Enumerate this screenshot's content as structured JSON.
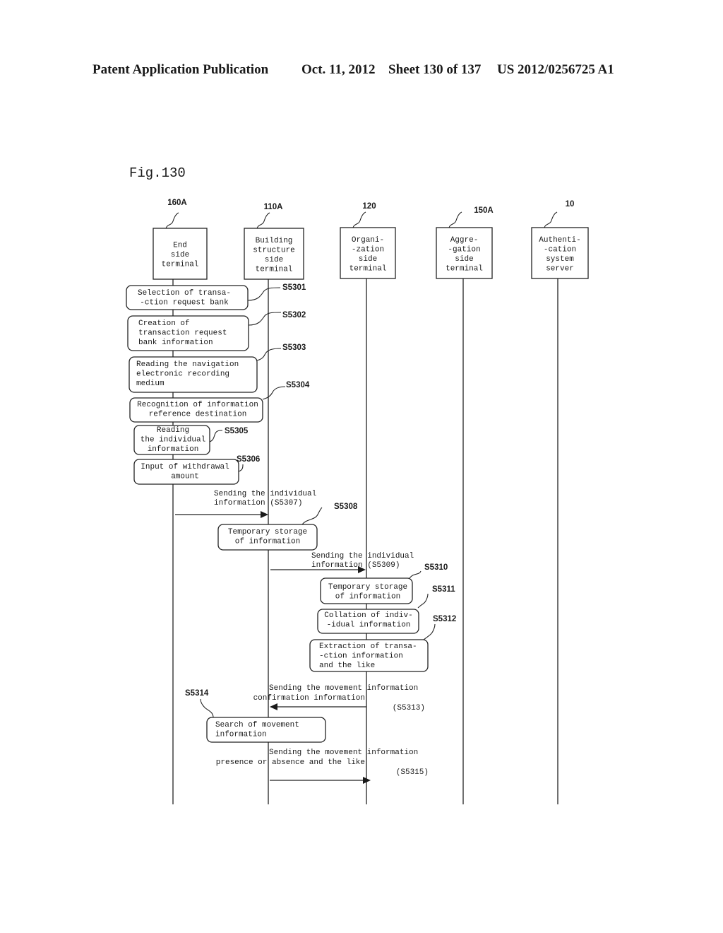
{
  "header": {
    "publication": "Patent Application Publication",
    "date": "Oct. 11, 2012",
    "sheet": "Sheet 130 of 137",
    "number": "US 2012/0256725 A1"
  },
  "figure": {
    "label": "Fig.130",
    "entities": [
      {
        "ref": "160A",
        "lines": [
          "End",
          "side",
          "terminal"
        ]
      },
      {
        "ref": "110A",
        "lines": [
          "Building",
          "structure",
          "side",
          "terminal"
        ]
      },
      {
        "ref": "120",
        "lines": [
          "Organi-",
          "-zation",
          "side",
          "terminal"
        ]
      },
      {
        "ref": "150A",
        "lines": [
          "Aggre-",
          "-gation",
          "side",
          "terminal"
        ]
      },
      {
        "ref": "10",
        "lines": [
          "Authenti-",
          "-cation",
          "system",
          "server"
        ]
      }
    ],
    "steps": [
      {
        "id": "S5301",
        "lines": [
          "Selection of transa-",
          "-ction request bank"
        ]
      },
      {
        "id": "S5302",
        "lines": [
          "Creation of",
          "transaction request",
          "bank information"
        ]
      },
      {
        "id": "S5303",
        "lines": [
          "Reading the navigation",
          "electronic recording",
          "medium"
        ]
      },
      {
        "id": "S5304",
        "lines": [
          "Recognition of information",
          "reference destination"
        ]
      },
      {
        "id": "S5305",
        "lines": [
          "Reading",
          "the individual",
          "information"
        ]
      },
      {
        "id": "S5306",
        "lines": [
          "Input of withdrawal",
          "amount"
        ]
      },
      {
        "id": "S5308",
        "lines": [
          "Temporary storage",
          "of information"
        ]
      },
      {
        "id": "S5310",
        "lines": [
          "Temporary storage",
          "of information"
        ]
      },
      {
        "id": "S5311",
        "lines": [
          "Collation of indiv-",
          "-idual information"
        ]
      },
      {
        "id": "S5312",
        "lines": [
          "Extraction of transa-",
          "-ction information",
          "and the like"
        ]
      },
      {
        "id": "S5314",
        "lines": [
          "Search of movement",
          "information"
        ]
      }
    ],
    "messages": [
      {
        "id": "S5307",
        "lines": [
          "Sending the individual",
          "information (S5307)"
        ]
      },
      {
        "id": "S5309",
        "lines": [
          "Sending the individual",
          "information (S5309)"
        ]
      },
      {
        "id": "S5313",
        "lines": [
          "Sending the movement information",
          "confirmation information",
          "(S5313)"
        ]
      },
      {
        "id": "S5315",
        "lines": [
          "Sending the movement information",
          "presence or absence and the like",
          "(S5315)"
        ]
      }
    ]
  }
}
